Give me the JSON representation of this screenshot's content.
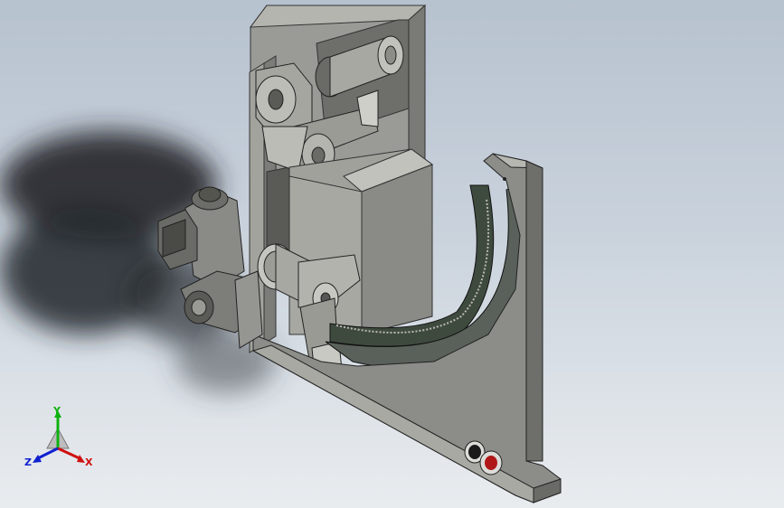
{
  "viewport": {
    "background_top": "#b7c2cf",
    "background_bottom": "#e9ecef"
  },
  "model": {
    "body_color": "#8f8f8c",
    "body_light": "#b3b3ae",
    "body_dark": "#5f5f5c",
    "arc_color": "#3f4a3f",
    "button_black": "#1a1a1a",
    "button_red": "#b01818"
  },
  "triad": {
    "x_label": "X",
    "y_label": "Y",
    "z_label": "Z",
    "x_color": "#d01010",
    "y_color": "#10b010",
    "z_color": "#1020d0"
  }
}
